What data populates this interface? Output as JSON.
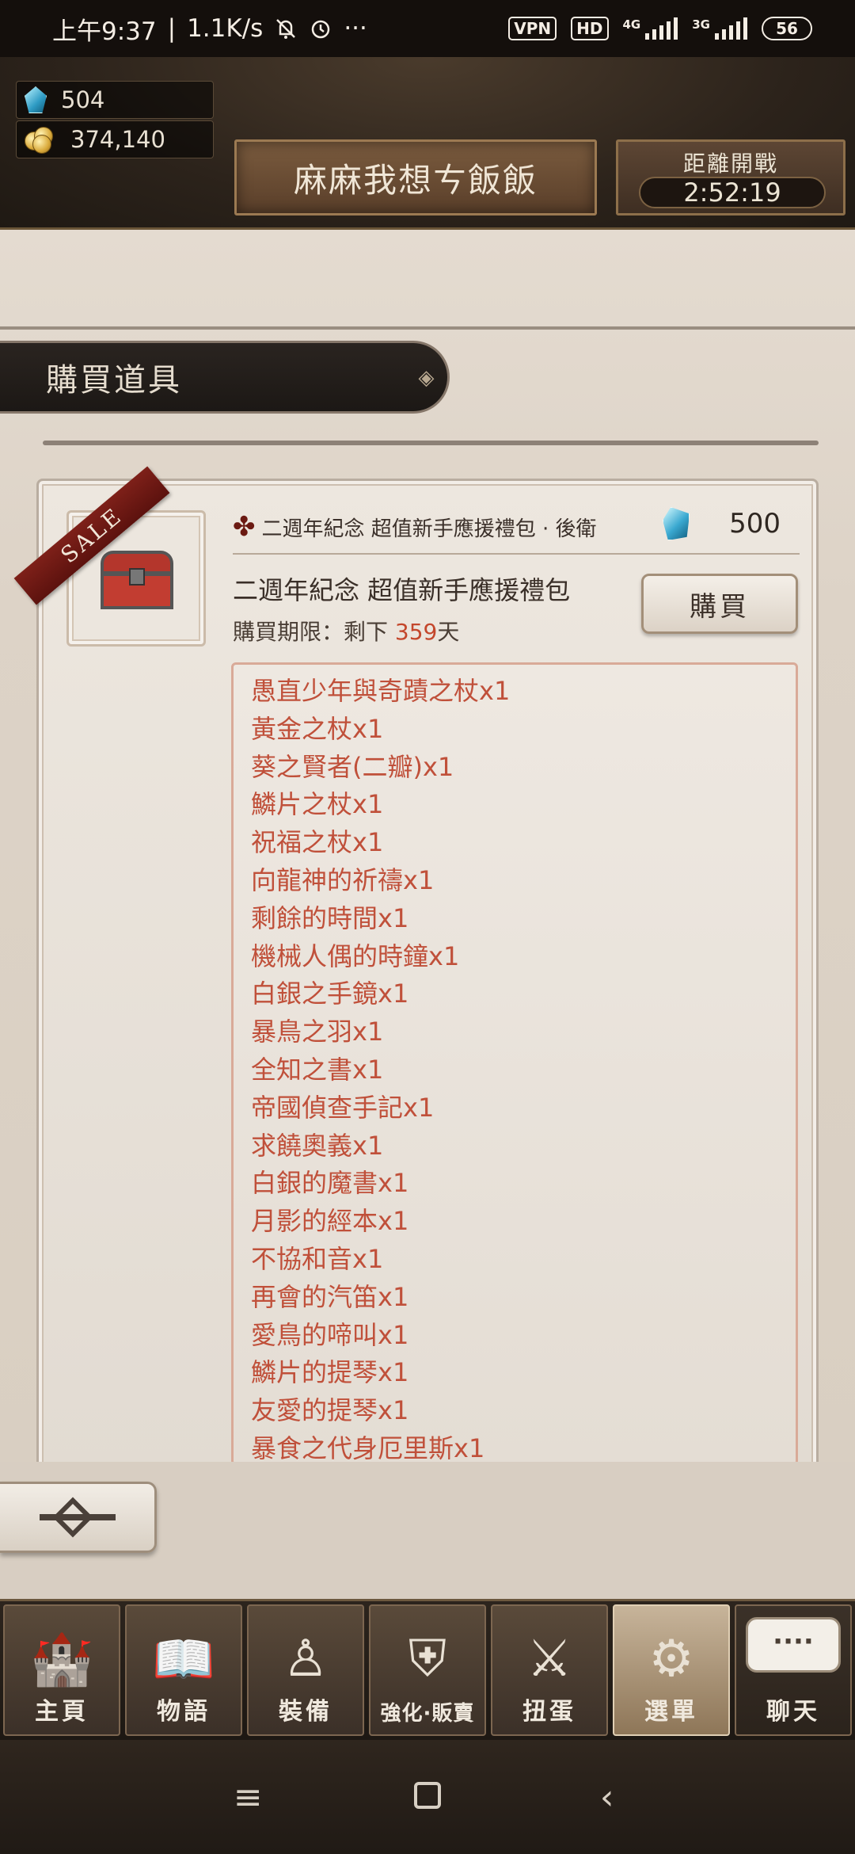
{
  "status_bar": {
    "time": "上午9:37",
    "speed": "1.1K/s",
    "vpn": "VPN",
    "hd": "HD",
    "net1": "4G",
    "net2": "3G",
    "battery": "56"
  },
  "header": {
    "gems": "504",
    "gold": "374,140",
    "player_name": "麻麻我想ㄘ飯飯",
    "timer_label": "距離開戰",
    "timer_value": "2:52:19"
  },
  "section": {
    "title": "購買道具"
  },
  "product": {
    "sale_badge": "SALE",
    "header_name": "二週年紀念 超值新手應援禮包 · 後衛",
    "price": "500",
    "title": "二週年紀念 超值新手應援禮包",
    "deadline_prefix": "購買期限：剩下",
    "deadline_days": "359",
    "deadline_suffix": "天",
    "buy_label": "購買",
    "items": [
      "愚直少年與奇蹟之杖x1",
      "黃金之杖x1",
      "葵之賢者(二瓣)x1",
      "鱗片之杖x1",
      "祝福之杖x1",
      "向龍神的祈禱x1",
      "剩餘的時間x1",
      "機械人偶的時鐘x1",
      "白銀之手鏡x1",
      "暴鳥之羽x1",
      "全知之書x1",
      "帝國偵查手記x1",
      "求饒奧義x1",
      "白銀的魔書x1",
      "月影的經本x1",
      "不協和音x1",
      "再會的汽笛x1",
      "愛鳥的啼叫x1",
      "鱗片的提琴x1",
      "友愛的提琴x1",
      "暴食之代身厄里斯x1"
    ]
  },
  "nav": {
    "home": "主頁",
    "story": "物語",
    "equip": "裝備",
    "enhance": "強化·販賣",
    "gacha": "扭蛋",
    "menu": "選單",
    "chat": "聊天",
    "chat_bubble": "····"
  },
  "icons": {
    "gem": "gem-icon",
    "gold": "coin-icon",
    "back": "back-arrow-icon"
  },
  "colors": {
    "accent_red": "#c0503a",
    "days_red": "#c4472c"
  }
}
